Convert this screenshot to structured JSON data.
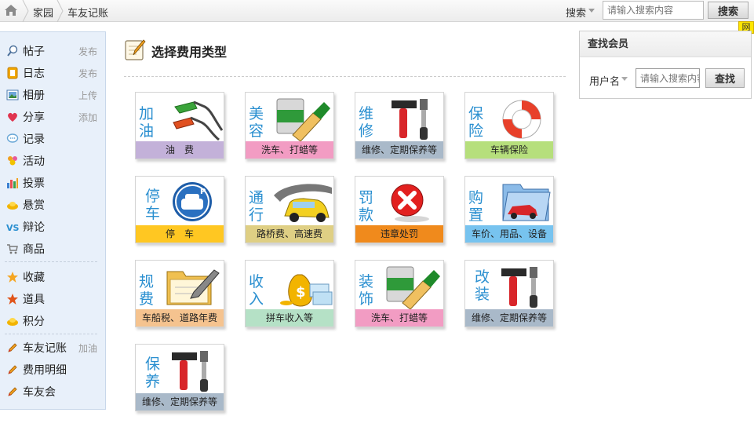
{
  "breadcrumb": {
    "items": [
      "家园",
      "车友记账"
    ]
  },
  "search": {
    "type_label": "搜索",
    "placeholder": "请输入搜索内容",
    "button_label": "搜索",
    "badge": "网"
  },
  "sidebar": {
    "groups": [
      [
        {
          "label": "帖子",
          "action": "发布",
          "icon": "post-icon"
        },
        {
          "label": "日志",
          "action": "发布",
          "icon": "blog-icon"
        },
        {
          "label": "相册",
          "action": "上传",
          "icon": "album-icon"
        },
        {
          "label": "分享",
          "action": "添加",
          "icon": "share-heart-icon"
        },
        {
          "label": "记录",
          "action": "",
          "icon": "speech-bubble-icon"
        },
        {
          "label": "活动",
          "action": "",
          "icon": "people-icon"
        },
        {
          "label": "投票",
          "action": "",
          "icon": "bar-chart-icon"
        },
        {
          "label": "悬赏",
          "action": "",
          "icon": "gold-ingot-icon"
        },
        {
          "label": "辩论",
          "action": "",
          "icon": "versus-icon"
        },
        {
          "label": "商品",
          "action": "",
          "icon": "shopping-cart-icon"
        }
      ],
      [
        {
          "label": "收藏",
          "action": "",
          "icon": "star-icon"
        },
        {
          "label": "道具",
          "action": "",
          "icon": "star-tool-icon"
        },
        {
          "label": "积分",
          "action": "",
          "icon": "gold-ingot-icon"
        }
      ],
      [
        {
          "label": "车友记账",
          "action": "加油",
          "icon": "pencil-icon"
        },
        {
          "label": "费用明细",
          "action": "",
          "icon": "pencil-icon"
        },
        {
          "label": "车友会",
          "action": "",
          "icon": "pencil-icon"
        }
      ]
    ]
  },
  "main": {
    "title": "选择费用类型",
    "tiles": [
      {
        "name": "加油",
        "caption": "油　费",
        "color": "#c3b1d9",
        "icon": "fuel-nozzle-icon"
      },
      {
        "name": "美容",
        "caption": "洗车、打蜡等",
        "color": "#f29cc3",
        "icon": "paint-bucket-icon"
      },
      {
        "name": "维修",
        "caption": "维修、定期保养等",
        "color": "#a9b9c9",
        "icon": "repair-tools-icon"
      },
      {
        "name": "保险",
        "caption": "车辆保险",
        "color": "#b6df7c",
        "icon": "life-ring-icon"
      },
      {
        "name": "停车",
        "caption": "停　车",
        "color": "#ffc722",
        "icon": "parking-sign-icon"
      },
      {
        "name": "通行",
        "caption": "路桥费、高速费",
        "color": "#dfcf84",
        "icon": "car-on-road-icon"
      },
      {
        "name": "罚款",
        "caption": "违章处罚",
        "color": "#f08a1c",
        "icon": "red-x-icon"
      },
      {
        "name": "购置",
        "caption": "车价、用品、设备",
        "color": "#77c3ef",
        "icon": "folder-car-icon"
      },
      {
        "name": "规费",
        "caption": "车船税、道路年费",
        "color": "#f5c38f",
        "icon": "folder-pen-icon"
      },
      {
        "name": "收入",
        "caption": "拼车收入等",
        "color": "#b5e1c6",
        "icon": "money-bags-icon"
      },
      {
        "name": "装饰",
        "caption": "洗车、打蜡等",
        "color": "#f29cc3",
        "icon": "paint-bucket-icon"
      },
      {
        "name": "改装",
        "caption": "维修、定期保养等",
        "color": "#a9b9c9",
        "icon": "repair-tools-icon"
      },
      {
        "name": "保养",
        "caption": "维修、定期保养等",
        "color": "#a9b9c9",
        "icon": "repair-tools-icon"
      }
    ]
  },
  "member_search": {
    "title": "查找会员",
    "field_label": "用户名",
    "placeholder": "请输入搜索内容",
    "button_label": "查找"
  }
}
